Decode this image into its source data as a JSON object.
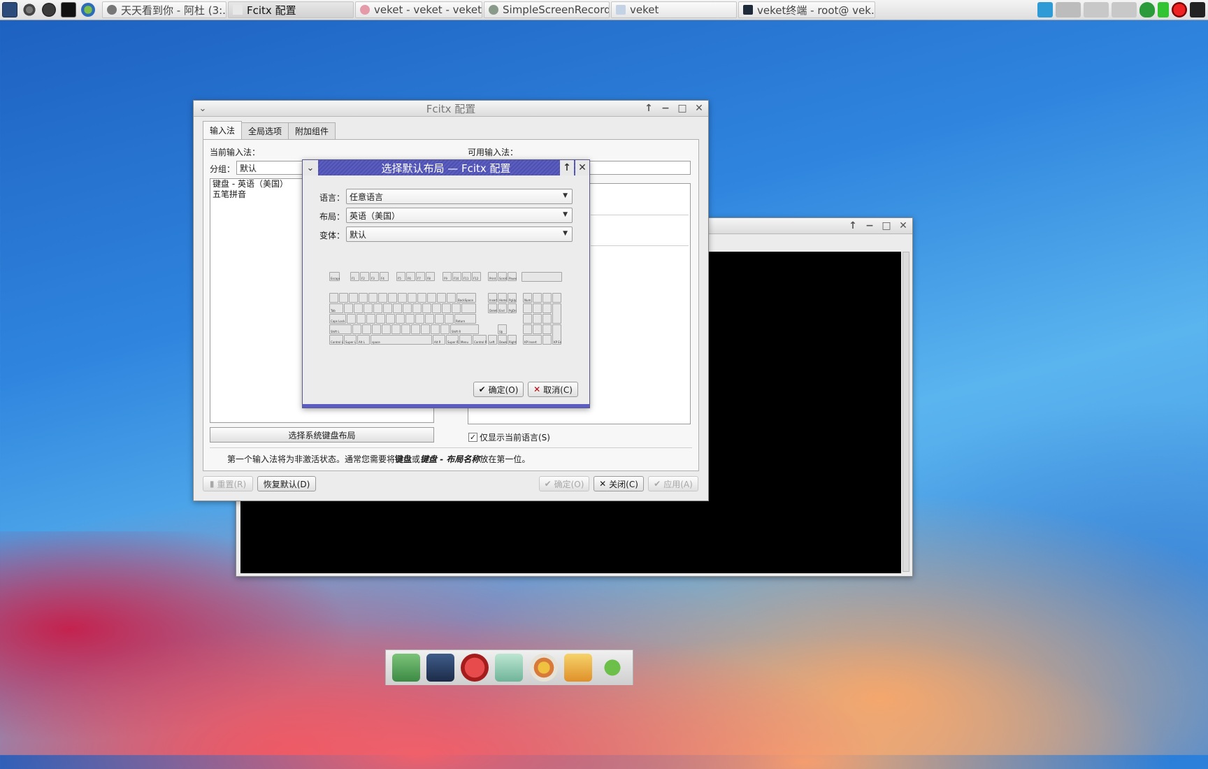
{
  "taskbar": {
    "launchers": [
      "system-monitor-icon",
      "settings-icon",
      "play-icon",
      "terminal-icon",
      "browser-icon"
    ],
    "tasks": [
      {
        "label": "天天看到你 - 阿杜 (3:...",
        "icon": "record-icon",
        "active": false
      },
      {
        "label": "Fcitx 配置",
        "icon": "fcitx-icon",
        "active": true
      },
      {
        "label": "veket - veket - veket ...",
        "icon": "web-icon",
        "active": false
      },
      {
        "label": "SimpleScreenRecorder",
        "icon": "recorder-icon",
        "active": false
      },
      {
        "label": "veket",
        "icon": "folder-icon",
        "active": false
      },
      {
        "label": "veket终端 - root@ vek...",
        "icon": "terminal-icon",
        "active": false
      }
    ],
    "tray": [
      "network-icon",
      "desktop-switch-icon",
      "shield-icon",
      "battery-icon",
      "record-dot-icon",
      "keyboard-icon"
    ]
  },
  "fcitx": {
    "title": "Fcitx 配置",
    "tabs": [
      "输入法",
      "全局选项",
      "附加组件"
    ],
    "current_im_label": "当前输入法：",
    "available_im_label": "可用输入法：",
    "group_label": "分组：",
    "group_value": "默认",
    "current_list": [
      "键盘 - 英语（美国）",
      "五笔拼音"
    ],
    "select_layout_button": "选择系统键盘布局",
    "only_current_lang": "仅显示当前语言(S)",
    "hint_prefix": "第一个输入法将为非激活状态。通常您需要将",
    "hint_bold1": "键盘",
    "hint_mid": "或",
    "hint_bold2": "键盘 - 布局名称",
    "hint_suffix": "放在第一位。",
    "btn_reset": "重置(R)",
    "btn_restore": "恢复默认(D)",
    "btn_ok": "确定(O)",
    "btn_close": "关闭(C)",
    "btn_apply": "应用(A)"
  },
  "dialog": {
    "title": "选择默认布局 — Fcitx 配置",
    "language_label": "语言：",
    "language_value": "任意语言",
    "layout_label": "布局：",
    "layout_value": "英语（美国）",
    "variant_label": "变体：",
    "variant_value": "默认",
    "ok": "确定(O)",
    "cancel": "取消(C)",
    "keyboard_labels": {
      "esc": "Escape",
      "backspace": "BackSpace",
      "tab": "Tab",
      "caps": "Caps Lock",
      "return": "Return",
      "shift_l": "Shift L",
      "shift_r": "Shift R",
      "control_l": "Control L",
      "super_l": "Super L",
      "alt_l": "Alt L",
      "space": "space",
      "alt_r": "Alt R",
      "super_r": "Super R",
      "menu": "Menu",
      "control_r": "Control R",
      "insert": "Insert",
      "home": "Home",
      "pgup": "PgUp",
      "delete": "Delete",
      "end": "End",
      "pgdn": "PgDn",
      "up": "Up",
      "left": "Left",
      "down": "Down",
      "right": "Right",
      "prnt": "Print",
      "scroll": "Scroll Lock",
      "pause": "Pause",
      "num_lock": "Num Lock",
      "kp_enter": "KP Enter",
      "kp_insert": "KP Insert"
    }
  },
  "dock": [
    "file-manager-icon",
    "monitor-icon",
    "game-icon",
    "editor-icon",
    "paint-icon",
    "media-icon",
    "help-icon"
  ]
}
